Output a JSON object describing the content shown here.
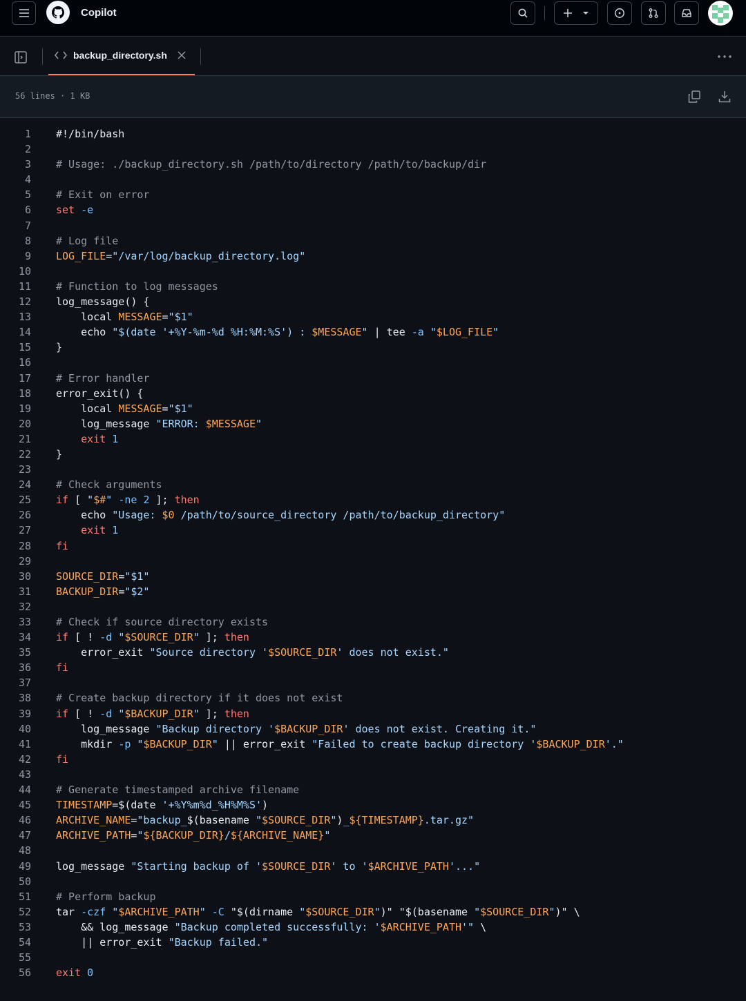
{
  "header": {
    "title": "Copilot",
    "icons": [
      "menu-icon",
      "github-logo",
      "search-icon",
      "plus-icon",
      "chevron-down-icon",
      "issue-icon",
      "pull-request-icon",
      "inbox-icon",
      "avatar"
    ]
  },
  "tab": {
    "filename": "backup_directory.sh"
  },
  "info": {
    "lines": "56 lines",
    "sep": "·",
    "size": "1 KB"
  },
  "code": [
    [
      [
        "i",
        "#!/bin/bash"
      ]
    ],
    [],
    [
      [
        "c",
        "# Usage: ./backup_directory.sh /path/to/directory /path/to/backup/dir"
      ]
    ],
    [],
    [
      [
        "c",
        "# Exit on error"
      ]
    ],
    [
      [
        "k",
        "set"
      ],
      [
        "i",
        " "
      ],
      [
        "n",
        "-e"
      ]
    ],
    [],
    [
      [
        "c",
        "# Log file"
      ]
    ],
    [
      [
        "v",
        "LOG_FILE"
      ],
      [
        "i",
        "="
      ],
      [
        "s",
        "\"/var/log/backup_directory.log\""
      ]
    ],
    [],
    [
      [
        "c",
        "# Function to log messages"
      ]
    ],
    [
      [
        "i",
        "log_message() {"
      ]
    ],
    [
      [
        "i",
        "    local "
      ],
      [
        "v",
        "MESSAGE"
      ],
      [
        "i",
        "="
      ],
      [
        "s",
        "\"$1\""
      ]
    ],
    [
      [
        "i",
        "    echo "
      ],
      [
        "s",
        "\"$(date '+%Y-%m-%d %H:%M:%S') : "
      ],
      [
        "v",
        "$MESSAGE"
      ],
      [
        "s",
        "\""
      ],
      [
        "i",
        " | tee "
      ],
      [
        "n",
        "-a"
      ],
      [
        "i",
        " "
      ],
      [
        "s",
        "\""
      ],
      [
        "v",
        "$LOG_FILE"
      ],
      [
        "s",
        "\""
      ]
    ],
    [
      [
        "i",
        "}"
      ]
    ],
    [],
    [
      [
        "c",
        "# Error handler"
      ]
    ],
    [
      [
        "i",
        "error_exit() {"
      ]
    ],
    [
      [
        "i",
        "    local "
      ],
      [
        "v",
        "MESSAGE"
      ],
      [
        "i",
        "="
      ],
      [
        "s",
        "\"$1\""
      ]
    ],
    [
      [
        "i",
        "    log_message "
      ],
      [
        "s",
        "\"ERROR: "
      ],
      [
        "v",
        "$MESSAGE"
      ],
      [
        "s",
        "\""
      ]
    ],
    [
      [
        "i",
        "    "
      ],
      [
        "k",
        "exit"
      ],
      [
        "i",
        " "
      ],
      [
        "n",
        "1"
      ]
    ],
    [
      [
        "i",
        "}"
      ]
    ],
    [],
    [
      [
        "c",
        "# Check arguments"
      ]
    ],
    [
      [
        "k",
        "if"
      ],
      [
        "i",
        " [ "
      ],
      [
        "s",
        "\""
      ],
      [
        "v",
        "$#"
      ],
      [
        "s",
        "\""
      ],
      [
        "i",
        " "
      ],
      [
        "n",
        "-ne"
      ],
      [
        "i",
        " "
      ],
      [
        "n",
        "2"
      ],
      [
        "i",
        " ]; "
      ],
      [
        "k",
        "then"
      ]
    ],
    [
      [
        "i",
        "    echo "
      ],
      [
        "s",
        "\"Usage: "
      ],
      [
        "v",
        "$0"
      ],
      [
        "s",
        " /path/to/source_directory /path/to/backup_directory\""
      ]
    ],
    [
      [
        "i",
        "    "
      ],
      [
        "k",
        "exit"
      ],
      [
        "i",
        " "
      ],
      [
        "n",
        "1"
      ]
    ],
    [
      [
        "k",
        "fi"
      ]
    ],
    [],
    [
      [
        "v",
        "SOURCE_DIR"
      ],
      [
        "i",
        "="
      ],
      [
        "s",
        "\"$1\""
      ]
    ],
    [
      [
        "v",
        "BACKUP_DIR"
      ],
      [
        "i",
        "="
      ],
      [
        "s",
        "\"$2\""
      ]
    ],
    [],
    [
      [
        "c",
        "# Check if source directory exists"
      ]
    ],
    [
      [
        "k",
        "if"
      ],
      [
        "i",
        " [ ! "
      ],
      [
        "n",
        "-d"
      ],
      [
        "i",
        " "
      ],
      [
        "s",
        "\""
      ],
      [
        "v",
        "$SOURCE_DIR"
      ],
      [
        "s",
        "\""
      ],
      [
        "i",
        " ]; "
      ],
      [
        "k",
        "then"
      ]
    ],
    [
      [
        "i",
        "    error_exit "
      ],
      [
        "s",
        "\"Source directory '"
      ],
      [
        "v",
        "$SOURCE_DIR"
      ],
      [
        "s",
        "' does not exist.\""
      ]
    ],
    [
      [
        "k",
        "fi"
      ]
    ],
    [],
    [
      [
        "c",
        "# Create backup directory if it does not exist"
      ]
    ],
    [
      [
        "k",
        "if"
      ],
      [
        "i",
        " [ ! "
      ],
      [
        "n",
        "-d"
      ],
      [
        "i",
        " "
      ],
      [
        "s",
        "\""
      ],
      [
        "v",
        "$BACKUP_DIR"
      ],
      [
        "s",
        "\""
      ],
      [
        "i",
        " ]; "
      ],
      [
        "k",
        "then"
      ]
    ],
    [
      [
        "i",
        "    log_message "
      ],
      [
        "s",
        "\"Backup directory '"
      ],
      [
        "v",
        "$BACKUP_DIR"
      ],
      [
        "s",
        "' does not exist. Creating it.\""
      ]
    ],
    [
      [
        "i",
        "    mkdir "
      ],
      [
        "n",
        "-p"
      ],
      [
        "i",
        " "
      ],
      [
        "s",
        "\""
      ],
      [
        "v",
        "$BACKUP_DIR"
      ],
      [
        "s",
        "\""
      ],
      [
        "i",
        " || error_exit "
      ],
      [
        "s",
        "\"Failed to create backup directory '"
      ],
      [
        "v",
        "$BACKUP_DIR"
      ],
      [
        "s",
        "'.\""
      ]
    ],
    [
      [
        "k",
        "fi"
      ]
    ],
    [],
    [
      [
        "c",
        "# Generate timestamped archive filename"
      ]
    ],
    [
      [
        "v",
        "TIMESTAMP"
      ],
      [
        "i",
        "=$(date "
      ],
      [
        "s",
        "'+%Y%m%d_%H%M%S'"
      ],
      [
        "i",
        ")"
      ]
    ],
    [
      [
        "v",
        "ARCHIVE_NAME"
      ],
      [
        "i",
        "="
      ],
      [
        "s",
        "\"backup_"
      ],
      [
        "i",
        "$(basename "
      ],
      [
        "s",
        "\""
      ],
      [
        "v",
        "$SOURCE_DIR"
      ],
      [
        "s",
        "\""
      ],
      [
        "i",
        ")"
      ],
      [
        "s",
        "_"
      ],
      [
        "v",
        "${TIMESTAMP}"
      ],
      [
        "s",
        ".tar.gz\""
      ]
    ],
    [
      [
        "v",
        "ARCHIVE_PATH"
      ],
      [
        "i",
        "="
      ],
      [
        "s",
        "\""
      ],
      [
        "v",
        "${BACKUP_DIR}"
      ],
      [
        "s",
        "/"
      ],
      [
        "v",
        "${ARCHIVE_NAME}"
      ],
      [
        "s",
        "\""
      ]
    ],
    [],
    [
      [
        "i",
        "log_message "
      ],
      [
        "s",
        "\"Starting backup of '"
      ],
      [
        "v",
        "$SOURCE_DIR"
      ],
      [
        "s",
        "' to '"
      ],
      [
        "v",
        "$ARCHIVE_PATH"
      ],
      [
        "s",
        "'...\""
      ]
    ],
    [],
    [
      [
        "c",
        "# Perform backup"
      ]
    ],
    [
      [
        "i",
        "tar "
      ],
      [
        "n",
        "-czf"
      ],
      [
        "i",
        " "
      ],
      [
        "s",
        "\""
      ],
      [
        "v",
        "$ARCHIVE_PATH"
      ],
      [
        "s",
        "\""
      ],
      [
        "i",
        " "
      ],
      [
        "n",
        "-C"
      ],
      [
        "i",
        " \"$(dirname "
      ],
      [
        "s",
        "\""
      ],
      [
        "v",
        "$SOURCE_DIR"
      ],
      [
        "s",
        "\""
      ],
      [
        "i",
        ")\" \"$(basename "
      ],
      [
        "s",
        "\""
      ],
      [
        "v",
        "$SOURCE_DIR"
      ],
      [
        "s",
        "\""
      ],
      [
        "i",
        ")\" \\"
      ]
    ],
    [
      [
        "i",
        "    && log_message "
      ],
      [
        "s",
        "\"Backup completed successfully: '"
      ],
      [
        "v",
        "$ARCHIVE_PATH"
      ],
      [
        "s",
        "'\""
      ],
      [
        "i",
        " \\"
      ]
    ],
    [
      [
        "i",
        "    || error_exit "
      ],
      [
        "s",
        "\"Backup failed.\""
      ]
    ],
    [],
    [
      [
        "k",
        "exit"
      ],
      [
        "i",
        " "
      ],
      [
        "n",
        "0"
      ]
    ]
  ]
}
